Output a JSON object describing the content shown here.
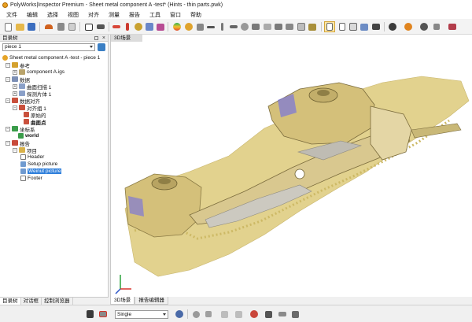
{
  "window": {
    "title": "PolyWorks|Inspector Premium - Sheet metal component A -test* (Hints - thin parts.pwk)"
  },
  "menu": [
    "文件",
    "编辑",
    "选择",
    "视图",
    "对齐",
    "测量",
    "报告",
    "工具",
    "窗口",
    "帮助"
  ],
  "tree_panel": {
    "title": "目录树",
    "piece_selector": "piece 1",
    "root": "Sheet metal component A -test - piece 1",
    "nodes": {
      "reference": "参考",
      "component": "component A.igs",
      "data": "数据",
      "surface_scan": "曲面扫描 1",
      "probe_pieces": "探测片体 1",
      "data_alignment": "数据对齐",
      "alignment_group": "对齐组 1",
      "original": "原始的",
      "curve_points": "曲面点",
      "coordinate_system": "坐标系",
      "world": "world",
      "report": "报告",
      "items": "项目",
      "header": "Header",
      "setup_picture": "Setup picture",
      "weinut_picture": "Weinut picture",
      "footer": "Footer"
    },
    "tabs": [
      "目录树",
      "对话框",
      "控制浏览器"
    ]
  },
  "viewport": {
    "tab_label": "3D场景",
    "bottom_tabs": [
      "3D场景",
      "报告编辑器"
    ],
    "colors": {
      "part": "#d9c88f",
      "scan": "#e2d28e",
      "accent": "#6f6ad8"
    }
  },
  "bottom_toolbar": {
    "mode": "Single"
  }
}
